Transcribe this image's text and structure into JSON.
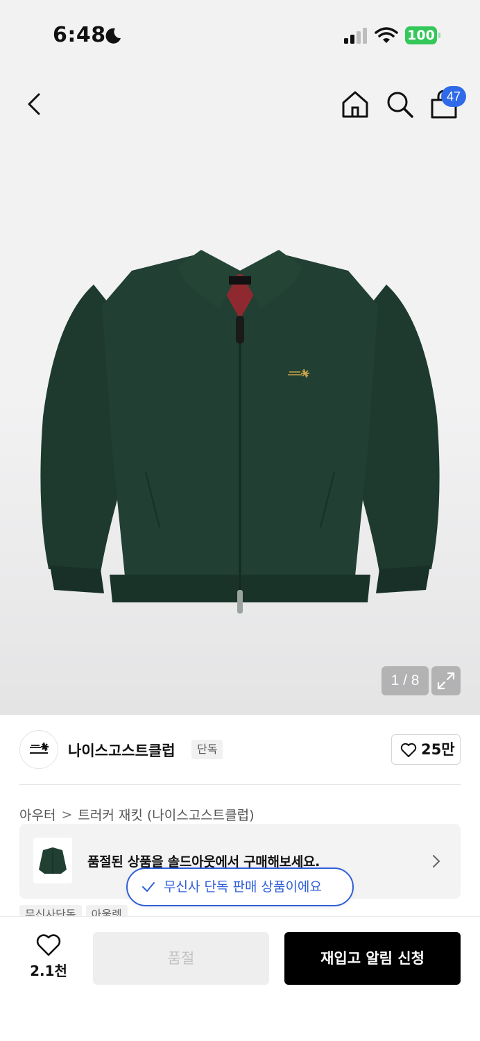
{
  "status_bar": {
    "time": "6:48",
    "battery": "100"
  },
  "nav": {
    "cart_count": "47"
  },
  "gallery": {
    "counter": "1 / 8"
  },
  "brand": {
    "name": "나이스고스트클럽",
    "exclusive_tag": "단독",
    "like_count": "25만"
  },
  "breadcrumb": {
    "category": "아우터",
    "separator": ">",
    "product": "트러커 재킷 (나이스고스트클럽)"
  },
  "soldout_banner": {
    "text": "품절된 상품을 솔드아웃에서 구매해보세요."
  },
  "toast": {
    "text": "무신사 단독 판매 상품이에요"
  },
  "tags": [
    "무신사단독",
    "아울렛"
  ],
  "bottom_bar": {
    "wish_count": "2.1천",
    "soldout_label": "품절",
    "restock_label": "재입고 알림 신청"
  },
  "colors": {
    "accent_blue": "#2f5fd8",
    "battery_green": "#34c759",
    "cart_badge": "#2f6ae8",
    "primary_button": "#000000",
    "jacket": "#1f3a2f"
  },
  "icons": [
    "moon-icon",
    "signal-icon",
    "wifi-icon",
    "back-arrow-icon",
    "home-icon",
    "search-icon",
    "shopping-bag-icon",
    "expand-icon",
    "heart-icon",
    "chevron-right-icon",
    "check-icon"
  ]
}
